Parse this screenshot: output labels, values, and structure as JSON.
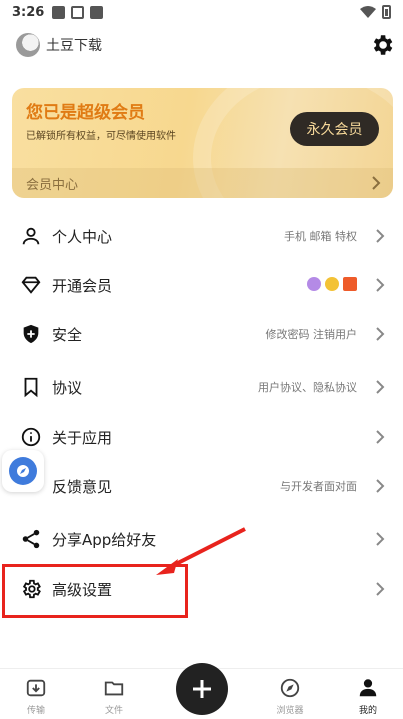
{
  "status_bar": {
    "time": "3:26"
  },
  "header": {
    "username": "土豆下载"
  },
  "vip_card": {
    "title": "您已是超级会员",
    "subtitle": "已解锁所有权益，可尽情使用软件",
    "button_label": "永久会员",
    "footer_label": "会员中心"
  },
  "menu": {
    "items": [
      {
        "label": "个人中心",
        "hint": "手机 邮箱 特权",
        "icon": "person-icon"
      },
      {
        "label": "开通会员",
        "hint": "",
        "icon": "diamond-icon",
        "badges": [
          "vip-badge",
          "diamond-badge",
          "gift-badge"
        ]
      },
      {
        "label": "安全",
        "hint": "修改密码  注销用户",
        "icon": "shield-icon"
      },
      {
        "label": "协议",
        "hint": "用户协议、隐私协议",
        "icon": "bookmark-icon"
      },
      {
        "label": "关于应用",
        "hint": "",
        "icon": "info-icon"
      },
      {
        "label": "反馈意见",
        "hint": "与开发者面对面",
        "icon": "feedback-icon"
      },
      {
        "label": "分享App给好友",
        "hint": "",
        "icon": "share-icon"
      },
      {
        "label": "高级设置",
        "hint": "",
        "icon": "gear-icon"
      }
    ]
  },
  "bottom_nav": {
    "tabs": [
      {
        "label": "传输",
        "icon": "download-tray-icon"
      },
      {
        "label": "文件",
        "icon": "folder-icon"
      },
      {
        "label": "浏览器",
        "icon": "compass-icon"
      },
      {
        "label": "我的",
        "icon": "user-icon"
      }
    ],
    "active": "我的"
  },
  "colors": {
    "vip_title": "#e07b14",
    "vip_button_bg": "#2f2a25",
    "annotation_red": "#e8231d",
    "fab_bg": "#222222"
  }
}
